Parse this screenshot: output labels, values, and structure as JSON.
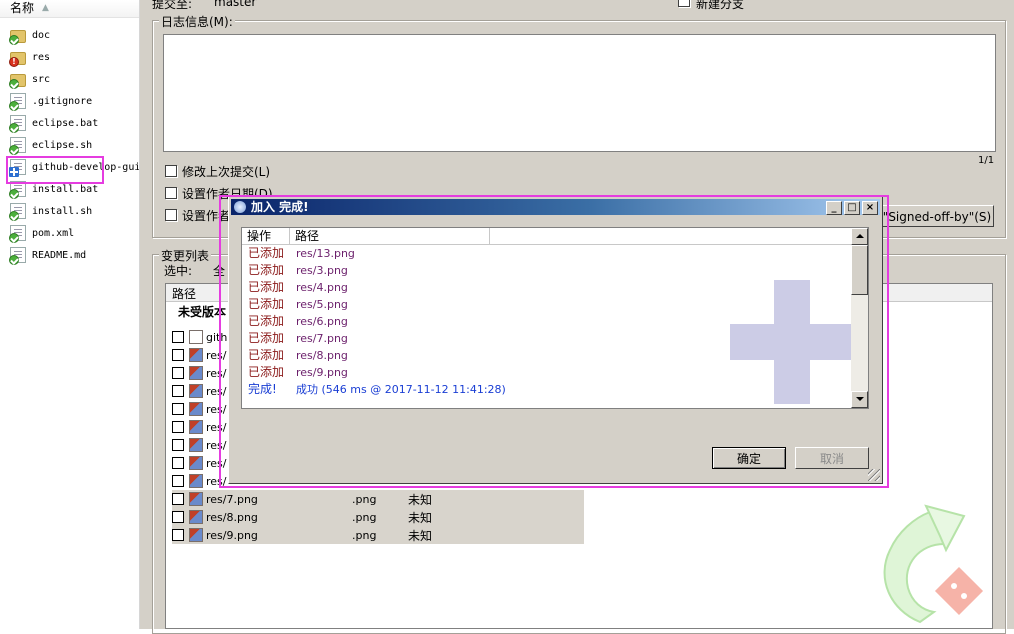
{
  "explorer": {
    "header_label": "名称",
    "files": [
      {
        "name": "doc",
        "kind": "folder",
        "status": "ok"
      },
      {
        "name": "res",
        "kind": "folder",
        "status": "error"
      },
      {
        "name": "src",
        "kind": "folder",
        "status": "ok"
      },
      {
        "name": ".gitignore",
        "kind": "doc",
        "status": "ok"
      },
      {
        "name": "eclipse.bat",
        "kind": "doc",
        "status": "ok"
      },
      {
        "name": "eclipse.sh",
        "kind": "doc",
        "status": "ok"
      },
      {
        "name": "github-develop-gui",
        "kind": "doc",
        "status": "added"
      },
      {
        "name": "install.bat",
        "kind": "doc",
        "status": "ok"
      },
      {
        "name": "install.sh",
        "kind": "doc",
        "status": "ok"
      },
      {
        "name": "pom.xml",
        "kind": "doc",
        "status": "ok"
      },
      {
        "name": "README.md",
        "kind": "doc",
        "status": "ok"
      }
    ]
  },
  "commit": {
    "commit_to_label": "提交至:",
    "branch": "master",
    "new_branch_label": "新建分支",
    "message_label": "日志信息(M):",
    "counter": "1/1",
    "amend_label": "修改上次提交(L)",
    "set_author_date_label": "设置作者日期(D)",
    "set_author_label": "设置作者",
    "signoff_button": "加\"Signed-off-by\"(S)",
    "changes_label": "变更列表",
    "select_label": "选中:",
    "select_all_fragment": "全",
    "column_path": "路径",
    "unversioned_label": "未受版本",
    "file_rows": [
      {
        "path": "gith",
        "ext": "",
        "status": ""
      },
      {
        "path": "res/",
        "ext": "",
        "status": ""
      },
      {
        "path": "res/",
        "ext": "",
        "status": ""
      },
      {
        "path": "res/",
        "ext": "",
        "status": ""
      },
      {
        "path": "res/",
        "ext": "",
        "status": ""
      },
      {
        "path": "res/",
        "ext": "",
        "status": ""
      },
      {
        "path": "res/",
        "ext": "",
        "status": ""
      },
      {
        "path": "res/",
        "ext": "",
        "status": ""
      },
      {
        "path": "res/",
        "ext": "",
        "status": ""
      },
      {
        "path": "res/7.png",
        "ext": ".png",
        "status": "未知"
      },
      {
        "path": "res/8.png",
        "ext": ".png",
        "status": "未知"
      },
      {
        "path": "res/9.png",
        "ext": ".png",
        "status": "未知"
      }
    ]
  },
  "dialog": {
    "title": "加入 完成!",
    "col_action": "操作",
    "col_path": "路径",
    "rows": [
      {
        "action": "已添加",
        "path": "res/13.png"
      },
      {
        "action": "已添加",
        "path": "res/3.png"
      },
      {
        "action": "已添加",
        "path": "res/4.png"
      },
      {
        "action": "已添加",
        "path": "res/5.png"
      },
      {
        "action": "已添加",
        "path": "res/6.png"
      },
      {
        "action": "已添加",
        "path": "res/7.png"
      },
      {
        "action": "已添加",
        "path": "res/8.png"
      },
      {
        "action": "已添加",
        "path": "res/9.png"
      }
    ],
    "done_action": "完成!",
    "done_text": "成功 (546 ms @ 2017-11-12 11:41:28)",
    "ok_button": "确定",
    "cancel_button": "取消",
    "colors": {
      "action_text": "#8b1a1a",
      "path_text": "#6b1f6b",
      "done_text": "#1a3ed4",
      "title_bar": "#0a246a"
    }
  },
  "colors": {
    "highlight": "#e53ce0",
    "window_bg": "#d4d0c8"
  }
}
